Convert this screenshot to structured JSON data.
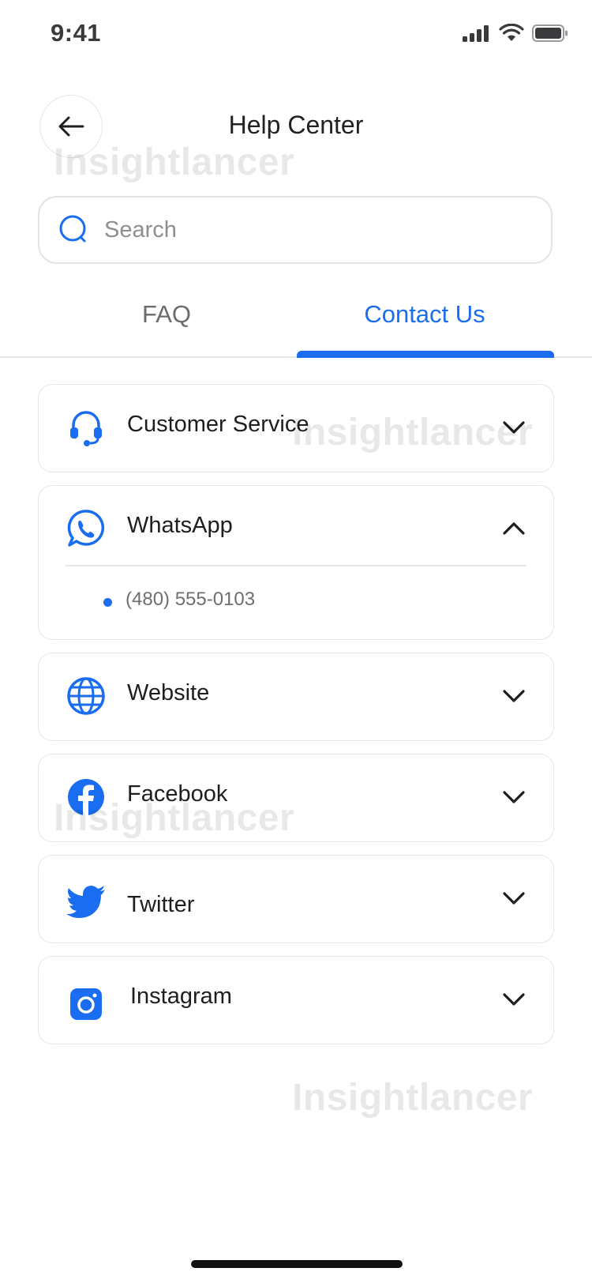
{
  "status_bar": {
    "time": "9:41"
  },
  "header": {
    "title": "Help Center"
  },
  "search": {
    "placeholder": "Search"
  },
  "tabs": [
    {
      "label": "FAQ",
      "active": false
    },
    {
      "label": "Contact Us",
      "active": true
    }
  ],
  "contacts": [
    {
      "label": "Customer Service",
      "icon": "headset-icon",
      "expanded": false
    },
    {
      "label": "WhatsApp",
      "icon": "whatsapp-icon",
      "expanded": true,
      "detail": "(480) 555-0103"
    },
    {
      "label": "Website",
      "icon": "globe-icon",
      "expanded": false
    },
    {
      "label": "Facebook",
      "icon": "facebook-icon",
      "expanded": false
    },
    {
      "label": "Twitter",
      "icon": "twitter-icon",
      "expanded": false
    },
    {
      "label": "Instagram",
      "icon": "instagram-icon",
      "expanded": false
    }
  ],
  "watermark": "Insightlancer",
  "colors": {
    "accent": "#1a6df0",
    "text": "#1c1c1e",
    "muted": "#6e6e73",
    "border": "#e6e6e8"
  }
}
